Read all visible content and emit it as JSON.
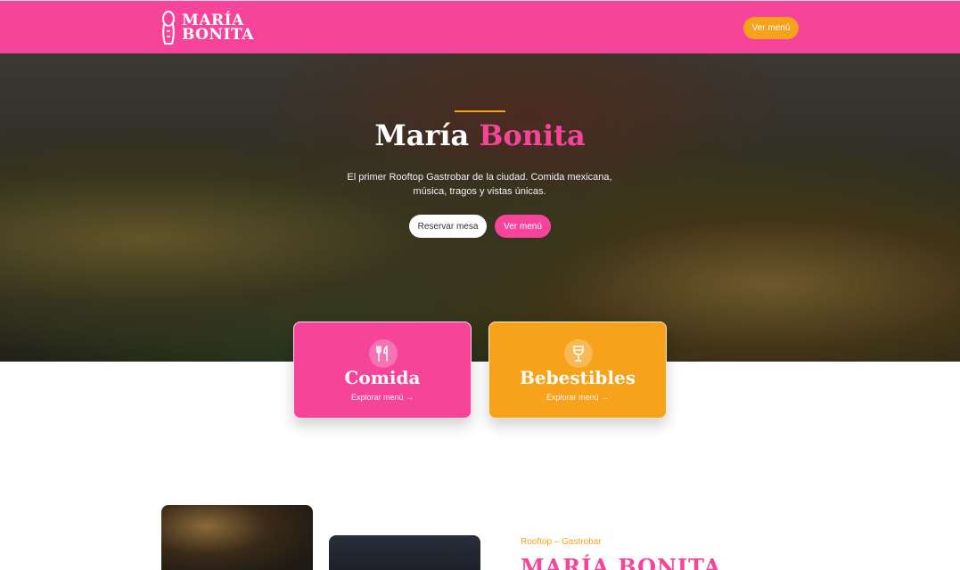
{
  "header": {
    "logo_line1": "MARÍA",
    "logo_line2": "BONITA",
    "cta_label": "Ver menú"
  },
  "hero": {
    "title_main": "María",
    "title_accent": "Bonita",
    "subtitle": "El primer Rooftop Gastrobar de la ciudad. Comida mexicana, música, tragos y vistas únicas.",
    "reserve_label": "Reservar mesa",
    "menu_label": "Ver menú"
  },
  "cards": [
    {
      "title": "Comida",
      "link": "Explorar menú →",
      "icon": "fork-knife-icon"
    },
    {
      "title": "Bebestibles",
      "link": "Explorar menú →",
      "icon": "wine-glass-icon"
    }
  ],
  "about": {
    "eyebrow": "Rooftop – Gastrobar",
    "title": "MARÍA BONITA"
  },
  "colors": {
    "brand_pink": "#f5449a",
    "brand_orange": "#f7a21b"
  }
}
